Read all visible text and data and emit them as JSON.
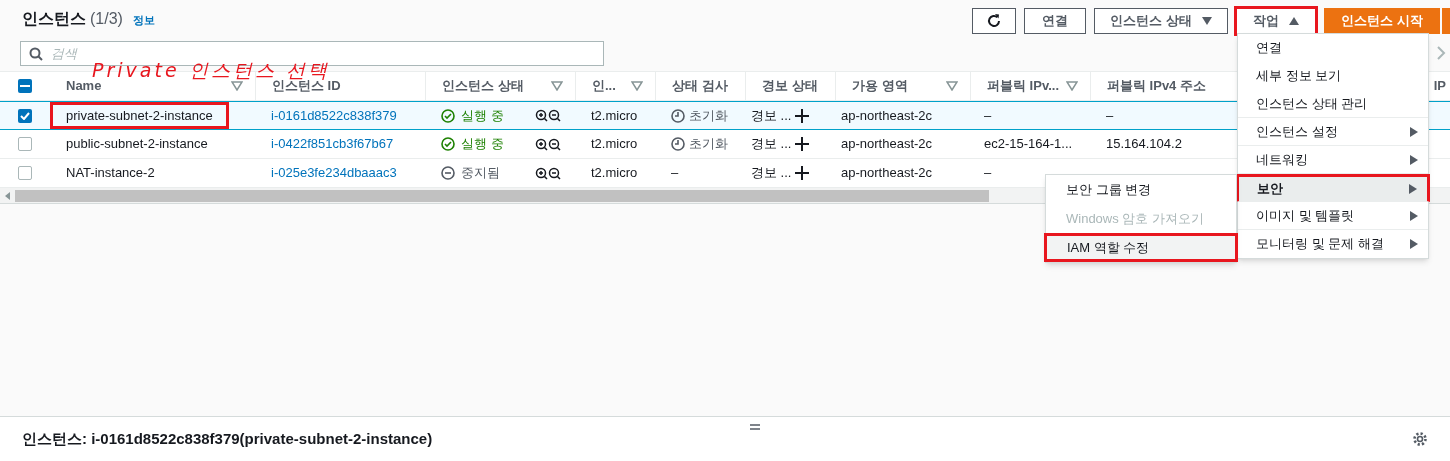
{
  "header": {
    "title": "인스턴스",
    "count": "(1/3)",
    "info_link": "정보"
  },
  "toolbar": {
    "buttons": [
      {
        "kind": "refresh"
      },
      {
        "kind": "plain",
        "label": "연결"
      },
      {
        "kind": "dropdown",
        "label": "인스턴스 상태",
        "expanded": false,
        "outlined": false
      },
      {
        "kind": "dropdown",
        "label": "작업",
        "expanded": true,
        "outlined": true
      },
      {
        "kind": "primary",
        "label": "인스턴스 시작"
      }
    ]
  },
  "search": {
    "placeholder": "검색"
  },
  "table": {
    "select_all": {
      "indeterminate": true
    },
    "columns": [
      {
        "label": "Name",
        "filter": true
      },
      {
        "label": "인스턴스 ID",
        "filter": false
      },
      {
        "label": "인스턴스 상태",
        "filter": true
      },
      {
        "label": "인...",
        "filter": true
      },
      {
        "label": "상태 검사",
        "filter": false
      },
      {
        "label": "경보 상태",
        "filter": false
      },
      {
        "label": "가용 영역",
        "filter": true
      },
      {
        "label": "퍼블릭 IPv...",
        "filter": true
      },
      {
        "label": "퍼블릭 IPv4 주소",
        "filter": false
      },
      {
        "label": "IP",
        "filter": false
      }
    ],
    "rows": [
      {
        "selected": true,
        "outlined": true,
        "name": "private-subnet-2-instance",
        "instance_id": "i-0161d8522c838f379",
        "state": {
          "kind": "running",
          "text": "실행 중"
        },
        "type": "t2.micro",
        "status_check": {
          "kind": "initializing",
          "text": "초기화"
        },
        "alarm": "경보 ...",
        "az": "ap-northeast-2c",
        "public_dns": "–",
        "public_ip": "–"
      },
      {
        "selected": false,
        "outlined": false,
        "name": "public-subnet-2-instance",
        "instance_id": "i-0422f851cb3f67b67",
        "state": {
          "kind": "running",
          "text": "실행 중"
        },
        "type": "t2.micro",
        "status_check": {
          "kind": "initializing",
          "text": "초기화"
        },
        "alarm": "경보 ...",
        "az": "ap-northeast-2c",
        "public_dns": "ec2-15-164-1...",
        "public_ip": "15.164.104.2"
      },
      {
        "selected": false,
        "outlined": false,
        "name": "NAT-instance-2",
        "instance_id": "i-025e3fe234dbaaac3",
        "state": {
          "kind": "stopped",
          "text": "중지됨"
        },
        "type": "t2.micro",
        "status_check": {
          "kind": "none",
          "text": "–"
        },
        "alarm": "경보 ...",
        "az": "ap-northeast-2c",
        "public_dns": "–"
      }
    ]
  },
  "actions_menu": {
    "items": [
      {
        "label": "연결",
        "submenu": false,
        "separator_after": false,
        "selected": false,
        "outlined": false
      },
      {
        "label": "세부 정보 보기",
        "submenu": false,
        "separator_after": false,
        "selected": false,
        "outlined": false
      },
      {
        "label": "인스턴스 상태 관리",
        "submenu": false,
        "separator_after": true,
        "selected": false,
        "outlined": false
      },
      {
        "label": "인스턴스 설정",
        "submenu": true,
        "separator_after": true,
        "selected": false,
        "outlined": false
      },
      {
        "label": "네트워킹",
        "submenu": true,
        "separator_after": true,
        "selected": false,
        "outlined": false
      },
      {
        "label": "보안",
        "submenu": true,
        "separator_after": true,
        "selected": true,
        "outlined": true
      },
      {
        "label": "이미지 및 템플릿",
        "submenu": true,
        "separator_after": true,
        "selected": false,
        "outlined": false
      },
      {
        "label": "모니터링 및 문제 해결",
        "submenu": true,
        "separator_after": false,
        "selected": false,
        "outlined": false
      }
    ]
  },
  "security_submenu": {
    "items": [
      {
        "label": "보안 그룹 변경",
        "disabled": false,
        "selected": false,
        "outlined": false
      },
      {
        "label": "Windows 암호 가져오기",
        "disabled": true,
        "selected": false,
        "outlined": false
      },
      {
        "label": "IAM 역할 수정",
        "disabled": false,
        "selected": true,
        "outlined": true
      }
    ]
  },
  "annotation": {
    "text": "Private 인스턴스 선택"
  },
  "details_panel": {
    "title": "인스턴스: i-0161d8522c838f379(private-subnet-2-instance)"
  }
}
